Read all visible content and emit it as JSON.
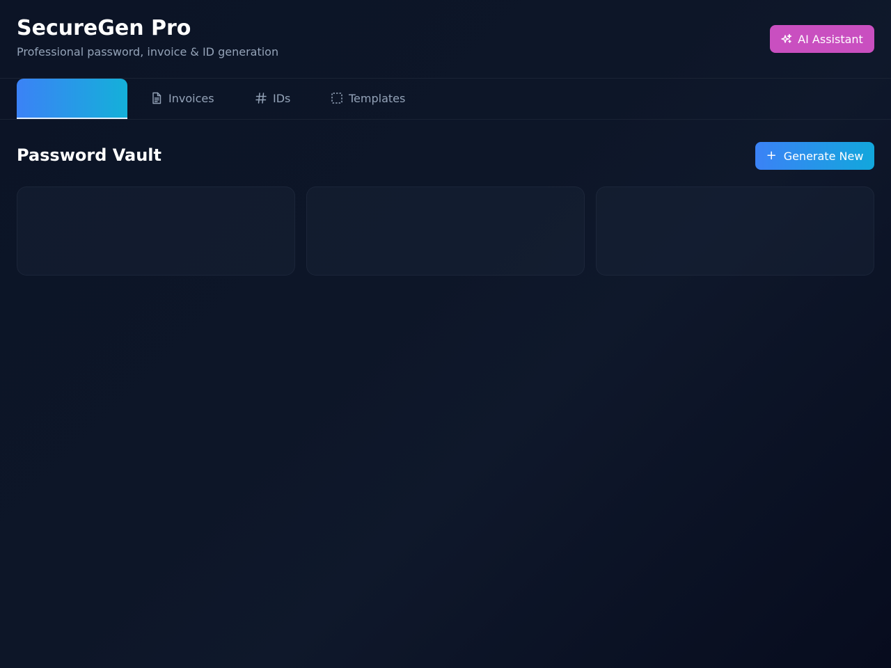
{
  "header": {
    "title": "SecureGen Pro",
    "subtitle": "Professional password, invoice & ID generation",
    "ai_button_label": "AI Assistant",
    "ai_button_icon": "sparkles-icon"
  },
  "tabs": [
    {
      "label": "",
      "icon": "",
      "active": true
    },
    {
      "label": "Invoices",
      "icon": "file-text-icon",
      "active": false
    },
    {
      "label": "IDs",
      "icon": "hash-icon",
      "active": false
    },
    {
      "label": "Templates",
      "icon": "dashed-square-icon",
      "active": false
    }
  ],
  "main": {
    "section_title": "Password Vault",
    "generate_button_label": "Generate New",
    "generate_button_icon": "plus-icon",
    "cards": [
      {},
      {},
      {}
    ]
  },
  "colors": {
    "accent_blue": "#3b82f6",
    "accent_cyan": "#14b0d9",
    "ai_magenta": "#c94fc0",
    "background": "#0c1426",
    "muted_text": "#94a3b8"
  }
}
